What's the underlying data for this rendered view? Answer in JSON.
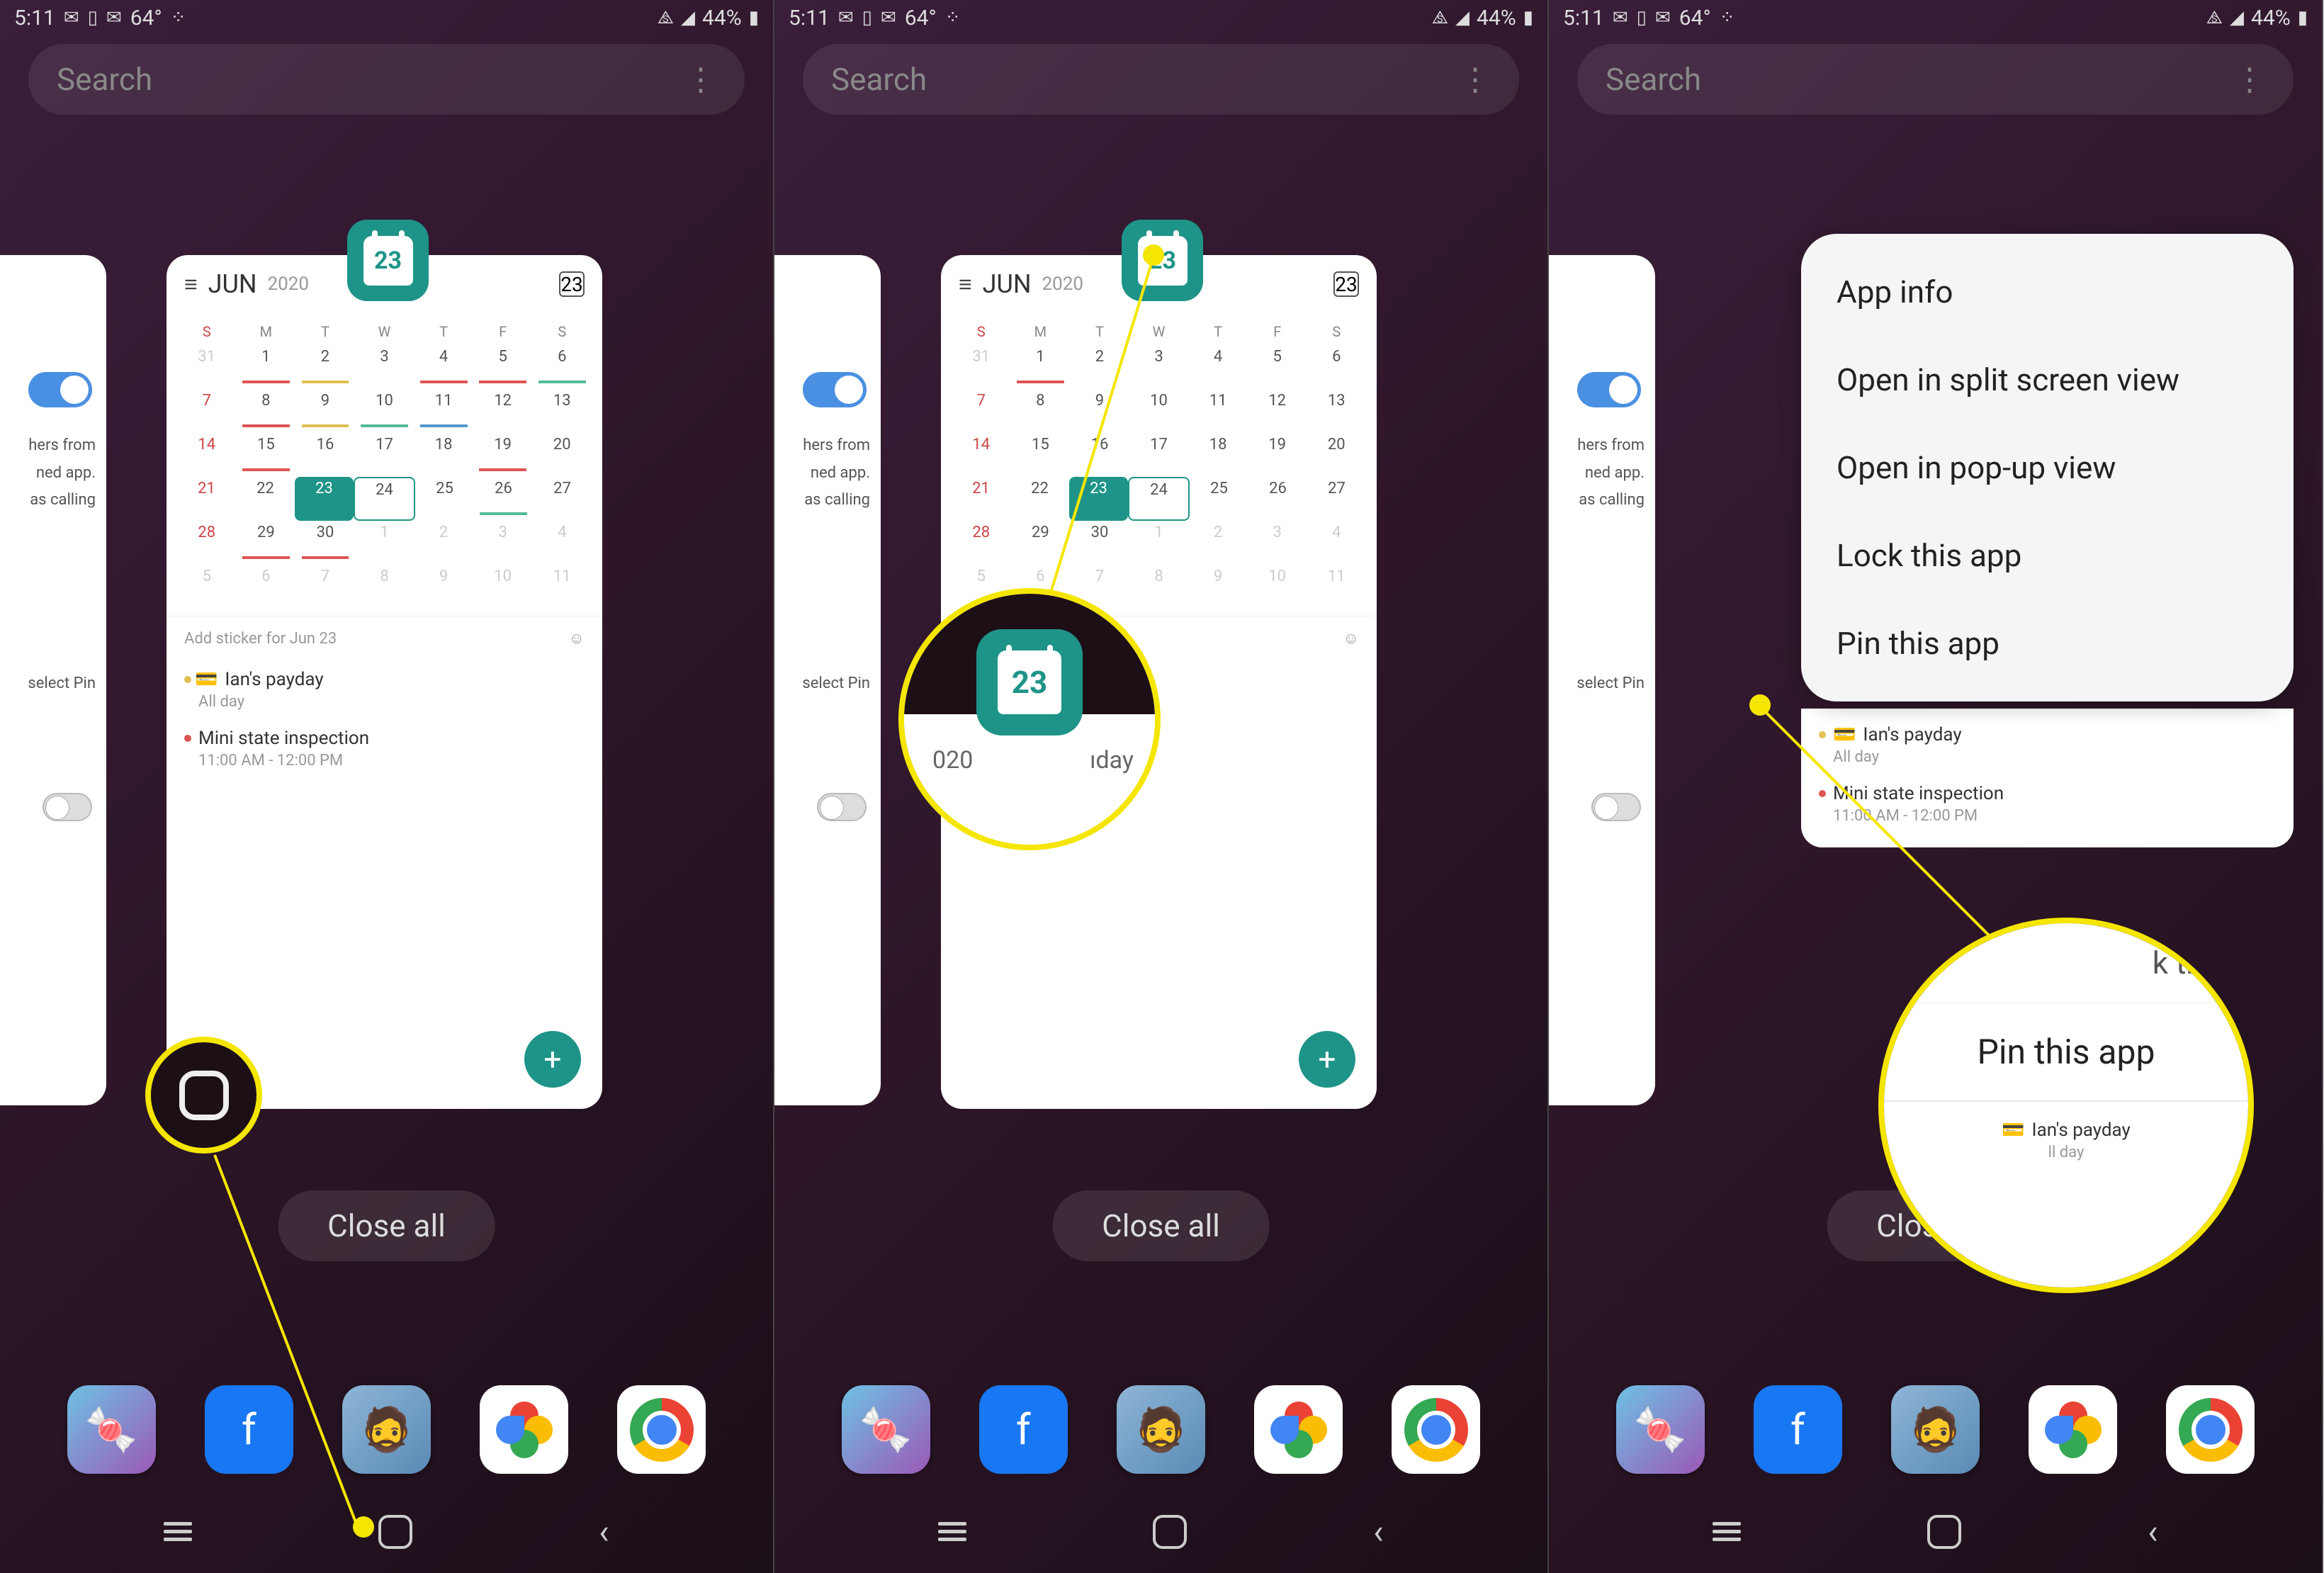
{
  "status": {
    "time": "5:11",
    "temp": "64°",
    "battery": "44%"
  },
  "search": {
    "placeholder": "Search",
    "menu": "⋮"
  },
  "calendar": {
    "month": "JUN",
    "year": "2020",
    "today_badge": "23",
    "app_icon_date": "23",
    "days": [
      "S",
      "M",
      "T",
      "W",
      "T",
      "F",
      "S"
    ],
    "sticker_hint": "Add sticker for Jun 23",
    "events": [
      {
        "title": "Ian's payday",
        "sub": "All day",
        "dot": "dot-y"
      },
      {
        "title": "Mini state inspection",
        "sub": "11:00 AM - 12:00 PM",
        "dot": "dot-r"
      }
    ],
    "fab": "+"
  },
  "peek": {
    "line1": "hers from",
    "line2": "ned app.",
    "line3": "as calling",
    "line4": "select Pin"
  },
  "close_all": "Close all",
  "nav": {
    "back": "‹"
  },
  "context_menu": {
    "items": [
      "App info",
      "Open in split screen view",
      "Open in pop-up view",
      "Lock this app",
      "Pin this app"
    ]
  },
  "mag2": {
    "year_fragment": "020",
    "event_fragment": "ıday"
  },
  "mag3": {
    "row1": "k this",
    "row2": "Pin this app",
    "row3_title": "Ian's payday",
    "row3_sub": "ll day"
  },
  "dock": {
    "game": "🍬",
    "fb": "f",
    "g2": "🧔"
  }
}
